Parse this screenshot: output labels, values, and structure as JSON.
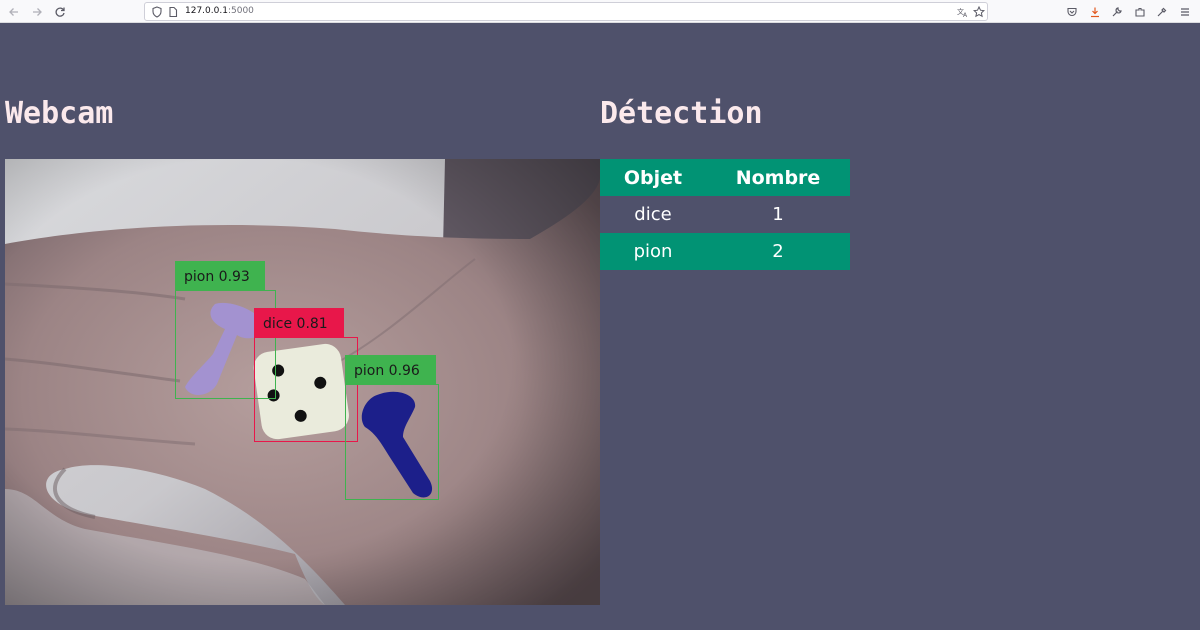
{
  "browser": {
    "url_host": "127.0.0.1",
    "url_port": ":5000"
  },
  "webcam": {
    "heading": "Webcam",
    "detections": [
      {
        "label": "pion 0.93",
        "color": "#3fb34f"
      },
      {
        "label": "dice 0.81",
        "color": "#e8174a"
      },
      {
        "label": "pion 0.96",
        "color": "#3fb34f"
      }
    ]
  },
  "detection": {
    "heading": "Détection",
    "columns": [
      "Objet",
      "Nombre"
    ],
    "rows": [
      {
        "objet": "dice",
        "nombre": "1"
      },
      {
        "objet": "pion",
        "nombre": "2"
      }
    ]
  },
  "colors": {
    "background": "#4f516b",
    "table_accent": "#019374",
    "heading_text": "#fbe9ec"
  }
}
